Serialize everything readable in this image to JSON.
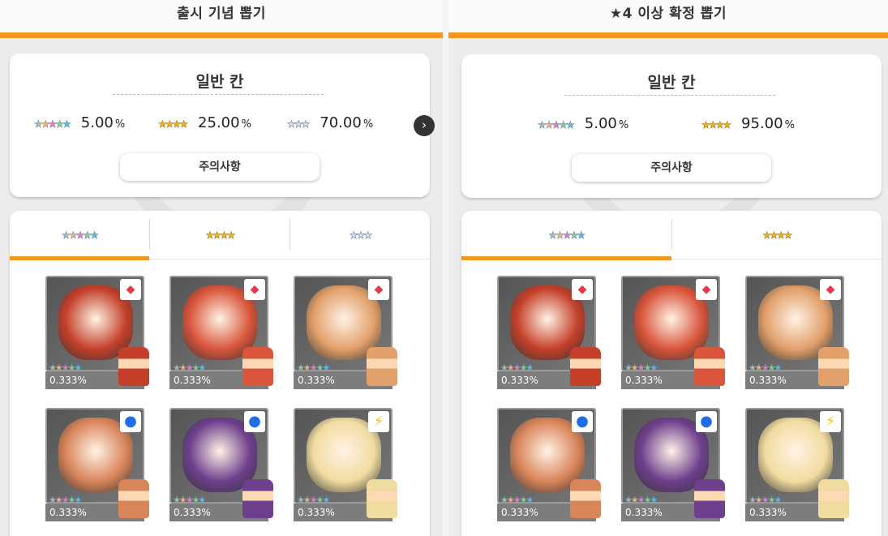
{
  "left": {
    "title": "출시 기념 뽑기",
    "card_title": "일반 칸",
    "rates": [
      {
        "stars": "★★★★★",
        "tier": "5-star",
        "value": "5.00",
        "unit": "%"
      },
      {
        "stars": "★★★★",
        "tier": "4-star",
        "value": "25.00",
        "unit": "%"
      },
      {
        "stars": "★★★",
        "tier": "3-star",
        "value": "70.00",
        "unit": "%"
      }
    ],
    "next_icon": "›",
    "notice_label": "주의사항",
    "tabs": [
      {
        "stars": "★★★★★",
        "active": true
      },
      {
        "stars": "★★★★",
        "active": false
      },
      {
        "stars": "★★★",
        "active": false
      }
    ]
  },
  "right": {
    "title": "★4 이상 확정 뽑기",
    "card_title": "일반 칸",
    "rates": [
      {
        "stars": "★★★★★",
        "tier": "5-star",
        "value": "5.00",
        "unit": "%"
      },
      {
        "stars": "★★★★",
        "tier": "4-star",
        "value": "95.00",
        "unit": "%"
      }
    ],
    "notice_label": "주의사항",
    "tabs": [
      {
        "stars": "★★★★★",
        "active": true
      },
      {
        "stars": "★★★★",
        "active": false
      }
    ]
  },
  "units": [
    {
      "stars": "★★★★★",
      "rate": "0.333%",
      "attribute": "fire-icon",
      "attr_glyph": "◆",
      "palette": "#c4402a"
    },
    {
      "stars": "★★★★★",
      "rate": "0.333%",
      "attribute": "fire-icon",
      "attr_glyph": "◆",
      "palette": "#d9553b"
    },
    {
      "stars": "★★★★★",
      "rate": "0.333%",
      "attribute": "fire-icon",
      "attr_glyph": "◆",
      "palette": "#e2a06a"
    },
    {
      "stars": "★★★★★",
      "rate": "0.333%",
      "attribute": "water-icon",
      "attr_glyph": "●",
      "palette": "#d9855a"
    },
    {
      "stars": "★★★★★",
      "rate": "0.333%",
      "attribute": "water-icon",
      "attr_glyph": "●",
      "palette": "#6e3f8c"
    },
    {
      "stars": "★★★★★",
      "rate": "0.333%",
      "attribute": "thunder-icon",
      "attr_glyph": "⚡",
      "palette": "#f1dca0"
    }
  ],
  "colors": {
    "accent": "#f4951f",
    "card": "#ffffff",
    "background": "#ececec"
  }
}
